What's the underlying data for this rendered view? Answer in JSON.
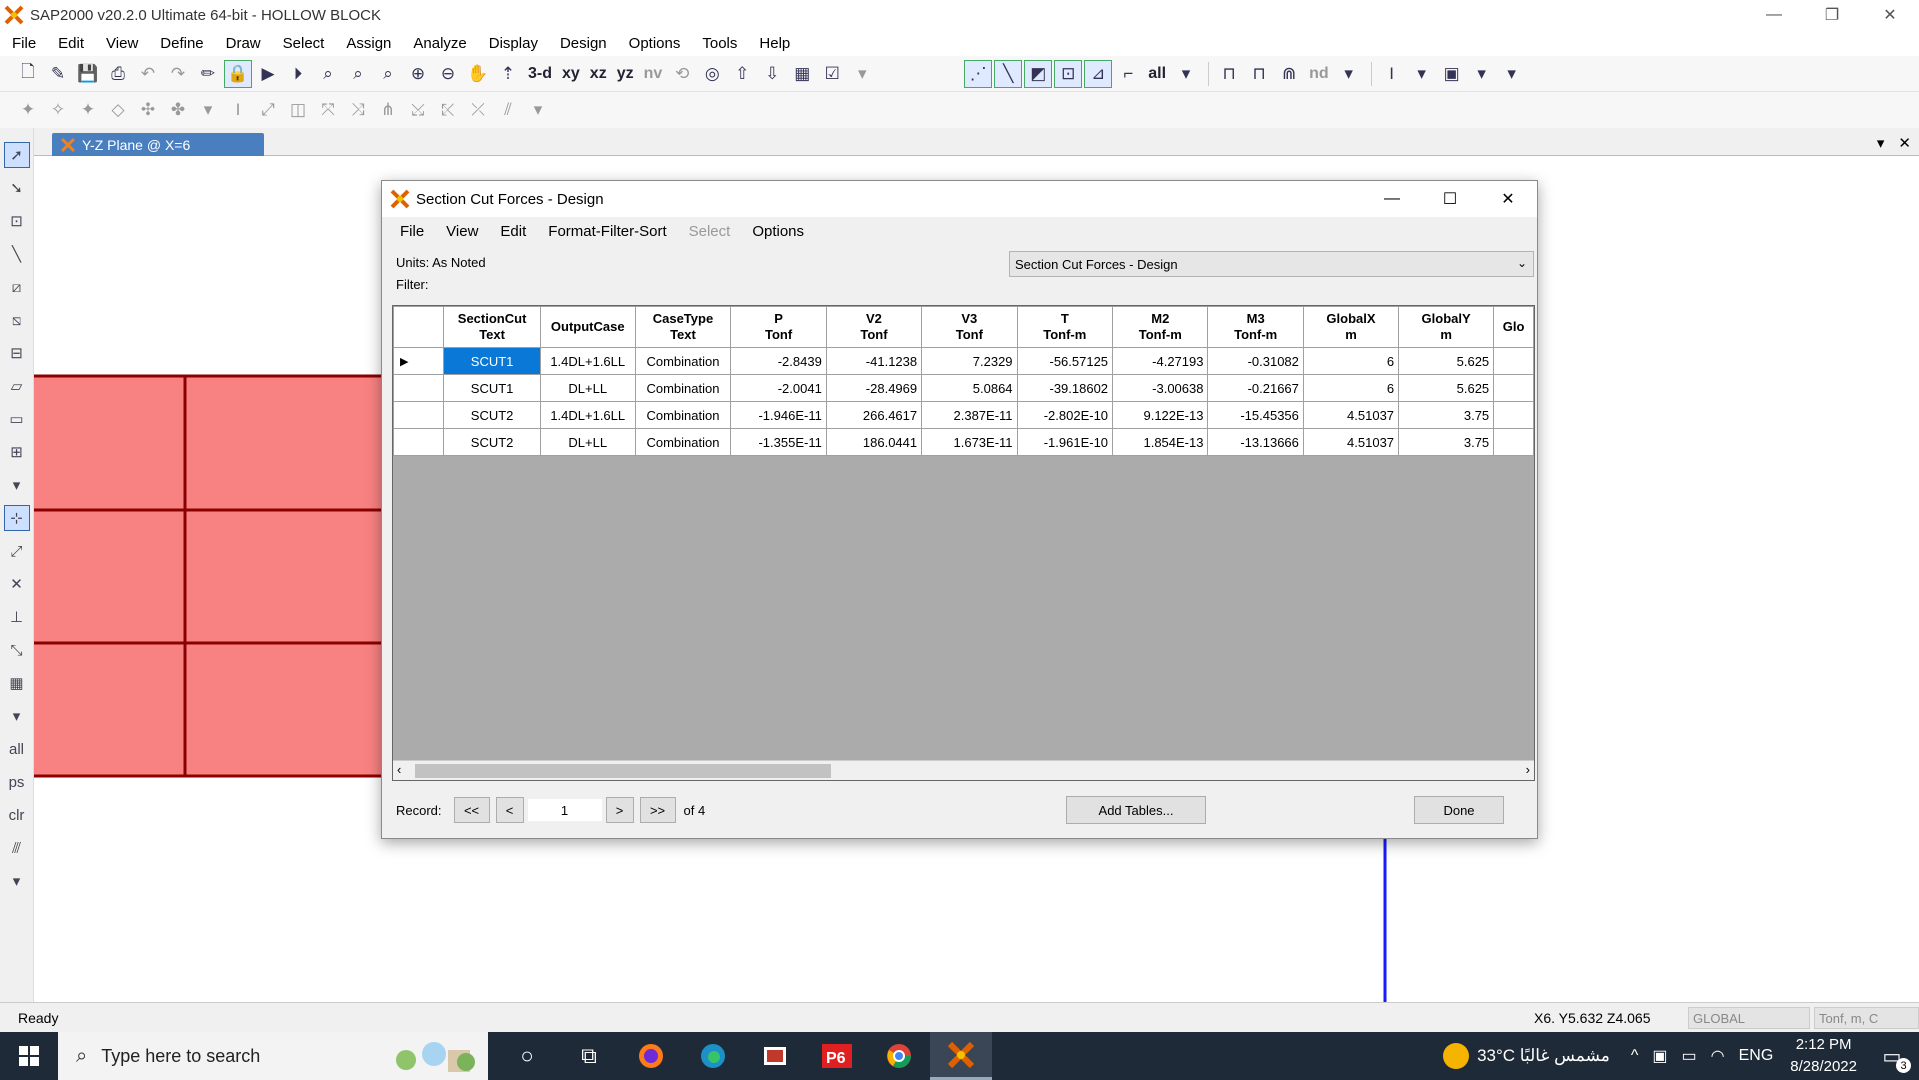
{
  "window": {
    "title": "SAP2000 v20.2.0 Ultimate 64-bit - HOLLOW BLOCK",
    "minimize": "—",
    "restore": "❐",
    "close": "✕"
  },
  "menu": [
    "File",
    "Edit",
    "View",
    "Define",
    "Draw",
    "Select",
    "Assign",
    "Analyze",
    "Display",
    "Design",
    "Options",
    "Tools",
    "Help"
  ],
  "toolbar": {
    "view_3d": "3-d",
    "view_xy": "xy",
    "view_xz": "xz",
    "view_yz": "yz",
    "view_nv": "nv",
    "all_label": "all",
    "nd_label": "nd"
  },
  "document_tab": {
    "label": "Y-Z Plane @ X=6",
    "dropdown": "▾",
    "close": "✕"
  },
  "canvas": {
    "fill_color": "#f88282",
    "line_color": "#8b0000",
    "axis_color": "#1a1aff"
  },
  "dialog": {
    "title": "Section Cut Forces - Design",
    "menu": [
      {
        "label": "File",
        "enabled": true
      },
      {
        "label": "View",
        "enabled": true
      },
      {
        "label": "Edit",
        "enabled": true
      },
      {
        "label": "Format-Filter-Sort",
        "enabled": true
      },
      {
        "label": "Select",
        "enabled": false
      },
      {
        "label": "Options",
        "enabled": true
      }
    ],
    "units_label": "Units:",
    "units_value": "As Noted",
    "filter_label": "Filter:",
    "table_select": "Section Cut Forces - Design",
    "columns": [
      {
        "name": "SectionCut",
        "unit": "Text"
      },
      {
        "name": "OutputCase",
        "unit": ""
      },
      {
        "name": "CaseType",
        "unit": "Text"
      },
      {
        "name": "P",
        "unit": "Tonf"
      },
      {
        "name": "V2",
        "unit": "Tonf"
      },
      {
        "name": "V3",
        "unit": "Tonf"
      },
      {
        "name": "T",
        "unit": "Tonf-m"
      },
      {
        "name": "M2",
        "unit": "Tonf-m"
      },
      {
        "name": "M3",
        "unit": "Tonf-m"
      },
      {
        "name": "GlobalX",
        "unit": "m"
      },
      {
        "name": "GlobalY",
        "unit": "m"
      },
      {
        "name": "Glo",
        "unit": ""
      }
    ],
    "rows": [
      [
        "SCUT1",
        "1.4DL+1.6LL",
        "Combination",
        "-2.8439",
        "-41.1238",
        "7.2329",
        "-56.57125",
        "-4.27193",
        "-0.31082",
        "6",
        "5.625",
        ""
      ],
      [
        "SCUT1",
        "DL+LL",
        "Combination",
        "-2.0041",
        "-28.4969",
        "5.0864",
        "-39.18602",
        "-3.00638",
        "-0.21667",
        "6",
        "5.625",
        ""
      ],
      [
        "SCUT2",
        "1.4DL+1.6LL",
        "Combination",
        "-1.946E-11",
        "266.4617",
        "2.387E-11",
        "-2.802E-10",
        "9.122E-13",
        "-15.45356",
        "4.51037",
        "3.75",
        ""
      ],
      [
        "SCUT2",
        "DL+LL",
        "Combination",
        "-1.355E-11",
        "186.0441",
        "1.673E-11",
        "-1.961E-10",
        "1.854E-13",
        "-13.13666",
        "4.51037",
        "3.75",
        ""
      ]
    ],
    "current_row_marker": "▶",
    "record_label": "Record:",
    "first": "<<",
    "prev": "<",
    "record_value": "1",
    "next": ">",
    "last": ">>",
    "of_count": "of 4",
    "add_tables": "Add Tables...",
    "done": "Done"
  },
  "status": {
    "text": "Ready",
    "coords": "X6.  Y5.632  Z4.065",
    "coord_system": "GLOBAL",
    "units": "Tonf, m, C"
  },
  "taskbar": {
    "search_placeholder": "Type here to search",
    "weather": "33°C  مشمس غالبًا",
    "language": "ENG",
    "time": "2:12 PM",
    "date": "8/28/2022",
    "notifications": "3"
  }
}
